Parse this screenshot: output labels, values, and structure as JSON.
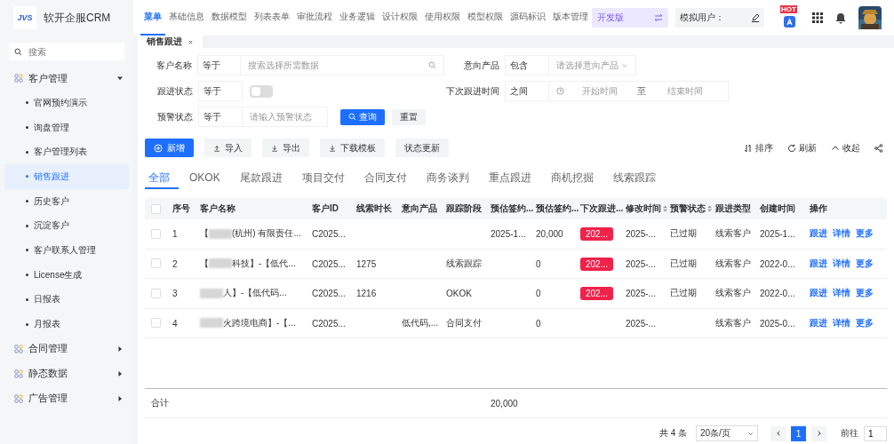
{
  "app": {
    "logo": "JVS",
    "title": "软开企服CRM"
  },
  "sidebar": {
    "search": {
      "placeholder": "搜索"
    },
    "groups": [
      {
        "label": "客户管理",
        "expanded": true,
        "children": [
          {
            "label": "官网预约演示",
            "selected": false
          },
          {
            "label": "询盘管理",
            "selected": false
          },
          {
            "label": "客户管理列表",
            "selected": false
          },
          {
            "label": "销售跟进",
            "selected": true
          },
          {
            "label": "历史客户",
            "selected": false
          },
          {
            "label": "沉淀客户",
            "selected": false
          },
          {
            "label": "客户联系人管理",
            "selected": false
          },
          {
            "label": "License生成",
            "selected": false
          },
          {
            "label": "日报表",
            "selected": false
          },
          {
            "label": "月报表",
            "selected": false
          }
        ]
      },
      {
        "label": "合同管理",
        "expanded": false
      },
      {
        "label": "静态数据",
        "expanded": false
      },
      {
        "label": "广告管理",
        "expanded": false
      }
    ]
  },
  "top_nav": {
    "items": [
      {
        "label": "菜单",
        "selected": true
      },
      {
        "label": "基础信息",
        "selected": false
      },
      {
        "label": "数据模型",
        "selected": false
      },
      {
        "label": "列表表单",
        "selected": false
      },
      {
        "label": "审批流程",
        "selected": false
      },
      {
        "label": "业务逻辑",
        "selected": false
      },
      {
        "label": "设计权限",
        "selected": false
      },
      {
        "label": "使用权限",
        "selected": false
      },
      {
        "label": "模型权限",
        "selected": false
      },
      {
        "label": "源码标识",
        "selected": false
      },
      {
        "label": "版本管理",
        "selected": false
      }
    ],
    "edition": "开发版",
    "mock_user": "模拟用户：",
    "hot_badge": "HOT"
  },
  "page_tabs": [
    {
      "label": "销售跟进",
      "selected": true
    }
  ],
  "filters": [
    {
      "kind": "search",
      "label": "客户名称",
      "operator": "等于",
      "placeholder": "搜索选择所需数据"
    },
    {
      "kind": "select",
      "label": "意向产品",
      "operator": "包含",
      "placeholder": "请选择意向产品"
    },
    {
      "kind": "toggle",
      "label": "跟进状态",
      "operator": "等于",
      "on": false
    },
    {
      "kind": "daterange",
      "label": "下次跟进时间",
      "operator": "之间",
      "start": "开始时间",
      "separator": "至",
      "end": "结束时间"
    },
    {
      "kind": "text",
      "label": "预警状态",
      "operator": "等于",
      "placeholder": "请输入预警状态"
    }
  ],
  "filter_buttons": [
    {
      "label": "查询",
      "kind": "primary"
    },
    {
      "label": "重置",
      "kind": "plain"
    }
  ],
  "toolbar": {
    "left": [
      {
        "label": "新增",
        "kind": "add"
      },
      {
        "label": "导入",
        "kind": "upload"
      },
      {
        "label": "导出",
        "kind": "download"
      },
      {
        "label": "下载模板",
        "kind": "download"
      },
      {
        "label": "状态更新",
        "kind": "plain"
      }
    ],
    "right": [
      {
        "label": "排序",
        "kind": "sort"
      },
      {
        "label": "刷新",
        "kind": "refresh"
      },
      {
        "label": "收起",
        "kind": "collapse"
      },
      {
        "kind": "share"
      }
    ]
  },
  "status_tabs": [
    {
      "label": "全部",
      "selected": true
    },
    {
      "label": "OKOK",
      "selected": false
    },
    {
      "label": "尾款跟进",
      "selected": false
    },
    {
      "label": "项目交付",
      "selected": false
    },
    {
      "label": "合同支付",
      "selected": false
    },
    {
      "label": "商务谈判",
      "selected": false
    },
    {
      "label": "重点跟进",
      "selected": false
    },
    {
      "label": "商机挖掘",
      "selected": false
    },
    {
      "label": "线索跟踪",
      "selected": false
    }
  ],
  "table": {
    "select_all": {
      "checked": false
    },
    "columns": [
      {
        "label": "序号",
        "kind": "text",
        "sortable": false
      },
      {
        "label": "客户名称",
        "kind": "name",
        "sortable": false
      },
      {
        "label": "客户ID",
        "kind": "text",
        "sortable": false
      },
      {
        "label": "线索时长",
        "kind": "text",
        "sortable": false
      },
      {
        "label": "意向产品",
        "kind": "text",
        "sortable": false
      },
      {
        "label": "跟踪阶段",
        "kind": "text",
        "sortable": false
      },
      {
        "label": "预估签约...",
        "kind": "text",
        "sortable": false
      },
      {
        "label": "预估签约...",
        "kind": "text",
        "sortable": false
      },
      {
        "label": "下次跟进...",
        "kind": "badge",
        "sortable": false
      },
      {
        "label": "修改时间",
        "kind": "text",
        "sortable": true
      },
      {
        "label": "预警状态",
        "kind": "text",
        "sortable": true
      },
      {
        "label": "跟进类型",
        "kind": "text",
        "sortable": false
      },
      {
        "label": "创建时间",
        "kind": "text",
        "sortable": false
      },
      {
        "label": "操作",
        "kind": "actions",
        "sortable": false
      }
    ],
    "rows": [
      {
        "checked": false,
        "cells": [
          "1",
          {
            "prefix": "【",
            "rest": "(杭州) 有限责任..."
          },
          "C2025...",
          null,
          null,
          null,
          "2025-1...",
          "20,000",
          "202...",
          "2025-...",
          "已过期",
          "线索客户",
          "2025-1...",
          [
            "跟进",
            "详情",
            "更多"
          ]
        ]
      },
      {
        "checked": false,
        "cells": [
          "2",
          {
            "prefix": "【",
            "rest": "科技】-【低代..."
          },
          "C2025...",
          "1275",
          null,
          "线索跟踪",
          null,
          "0",
          "202...",
          "2025-...",
          "已过期",
          "线索客户",
          "2022-0...",
          [
            "跟进",
            "详情",
            "更多"
          ]
        ]
      },
      {
        "checked": false,
        "cells": [
          "3",
          {
            "rest": "人】-【低代码..."
          },
          "C2025...",
          "1216",
          null,
          "OKOK",
          null,
          "0",
          "202...",
          "2025-...",
          "已过期",
          "线索客户",
          "2022-0...",
          [
            "跟进",
            "详情",
            "更多"
          ]
        ]
      },
      {
        "checked": false,
        "cells": [
          "4",
          {
            "rest": "火跨境电商】-【..."
          },
          "C2025...",
          null,
          "低代码,...",
          "合同支付",
          null,
          "0",
          null,
          "2025-...",
          null,
          "线索客户",
          "2025-0...",
          [
            "跟进",
            "详情",
            "更多"
          ]
        ]
      }
    ],
    "summary": {
      "label": "合计",
      "amount": "20,000"
    }
  },
  "pagination": {
    "total": "共 4 条",
    "page_size": "20条/页",
    "pages": [
      {
        "label": "1",
        "selected": true
      }
    ],
    "goto_label": "前往",
    "goto_value": "1"
  }
}
